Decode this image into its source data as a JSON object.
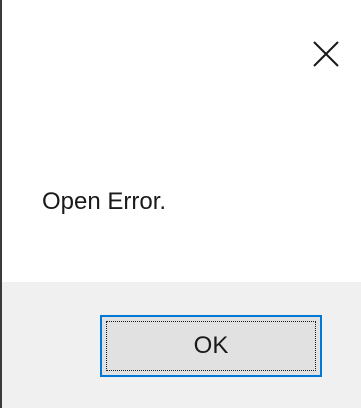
{
  "dialog": {
    "message": "Open Error.",
    "ok_label": "OK",
    "close_icon": "close-icon"
  },
  "colors": {
    "accent": "#0078d7",
    "footer_bg": "#f0f0f0",
    "button_bg": "#e1e1e1"
  }
}
